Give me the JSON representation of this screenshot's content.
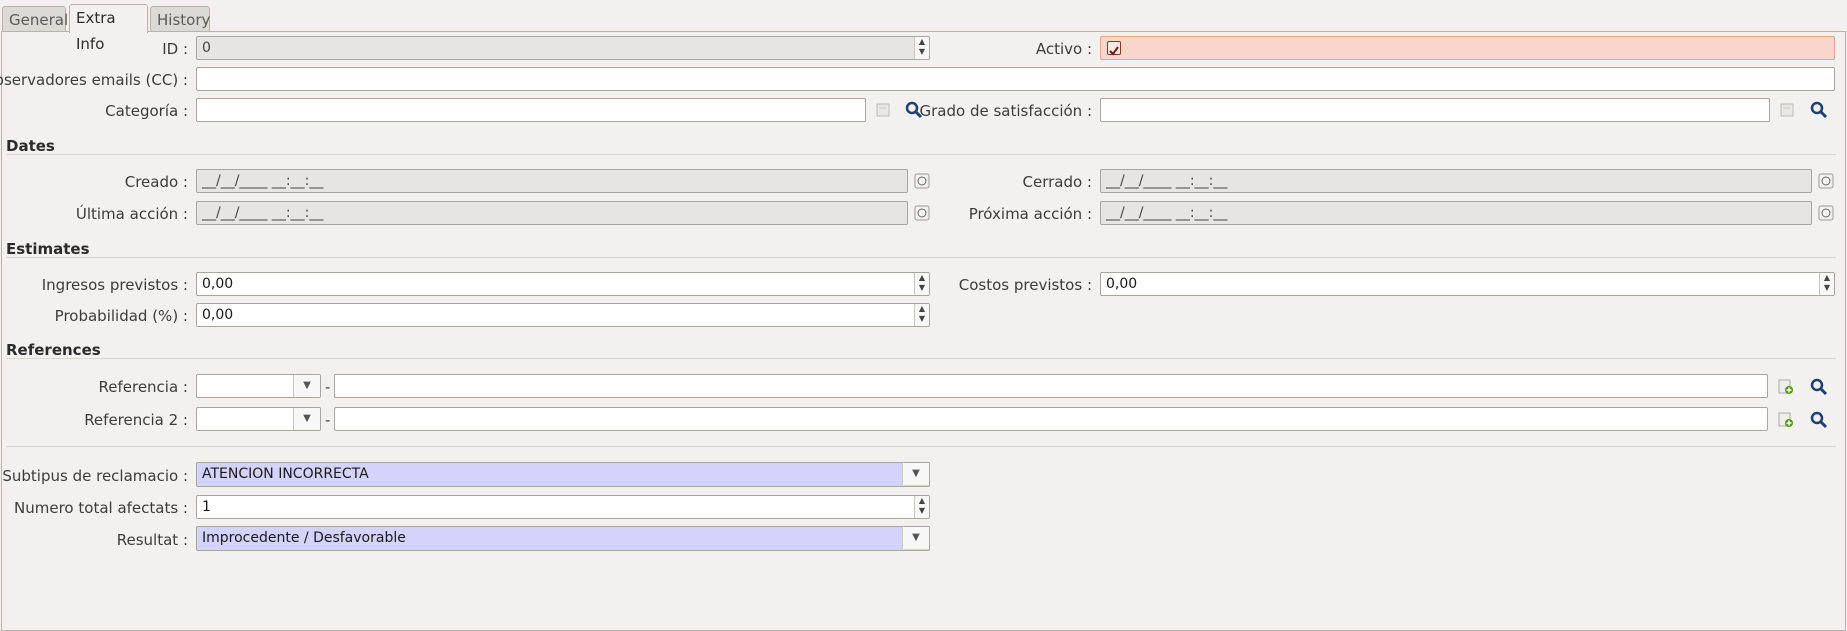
{
  "tabs": [
    {
      "label": "General"
    },
    {
      "label": "Extra Info"
    },
    {
      "label": "History"
    }
  ],
  "fields": {
    "id": {
      "label": "ID :",
      "value": "0"
    },
    "activo": {
      "label": "Activo :",
      "checked": true
    },
    "observadores": {
      "label": "Observadores emails (CC) :",
      "value": ""
    },
    "categoria": {
      "label": "Categoría :",
      "value": ""
    },
    "grado": {
      "label": "Grado de satisfacción :",
      "value": ""
    }
  },
  "dates": {
    "title": "Dates",
    "creado": {
      "label": "Creado :",
      "value": "__/__/____  __:__:__"
    },
    "cerrado": {
      "label": "Cerrado :",
      "value": "__/__/____  __:__:__"
    },
    "ultima": {
      "label": "Última acción :",
      "value": "__/__/____  __:__:__"
    },
    "proxima": {
      "label": "Próxima acción :",
      "value": "__/__/____  __:__:__"
    }
  },
  "estimates": {
    "title": "Estimates",
    "ingresos": {
      "label": "Ingresos previstos :",
      "value": "0,00"
    },
    "costos": {
      "label": "Costos previstos :",
      "value": "0,00"
    },
    "probabilidad": {
      "label": "Probabilidad (%) :",
      "value": "0,00"
    }
  },
  "references": {
    "title": "References",
    "ref1": {
      "label": "Referencia :",
      "separator": "-"
    },
    "ref2": {
      "label": "Referencia 2 :",
      "separator": "-"
    }
  },
  "extra": {
    "subtipus": {
      "label": "Subtipus de reclamacio :",
      "value": "ATENCION INCORRECTA"
    },
    "numero": {
      "label": "Numero total afectats :",
      "value": "1"
    },
    "resultat": {
      "label": "Resultat :",
      "value": "Improcedente / Desfavorable"
    }
  },
  "colors": {
    "required": "#d4d3fb",
    "readonly": "#e6e5e3",
    "highlight": "#f8d6cc"
  }
}
